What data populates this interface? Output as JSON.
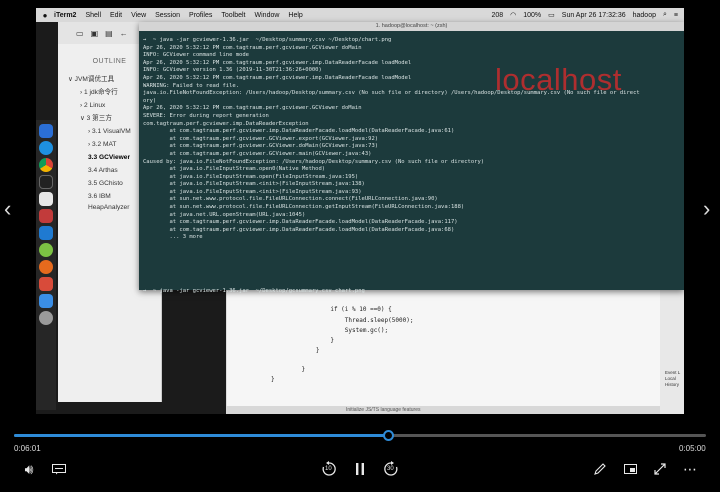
{
  "menubar": {
    "items": [
      "iTerm2",
      "Shell",
      "Edit",
      "View",
      "Session",
      "Profiles",
      "Toolbelt",
      "Window",
      "Help"
    ],
    "battery": "100%",
    "datetime": "Sun Apr 26  17:32:36",
    "user": "hadoop",
    "temp": "208"
  },
  "outline": {
    "title": "OUTLINE",
    "items": [
      {
        "label": "∨ JVM调优工具",
        "level": 0
      },
      {
        "label": "› 1 jdk命令行",
        "level": 1
      },
      {
        "label": "› 2 Linux",
        "level": 1
      },
      {
        "label": "∨ 3 第三方",
        "level": 1
      },
      {
        "label": "› 3.1 VisualVM",
        "level": 2
      },
      {
        "label": "› 3.2 MAT",
        "level": 2
      },
      {
        "label": "3.3 GCViewer",
        "level": 2,
        "active": true
      },
      {
        "label": "3.4 Arthas",
        "level": 2
      },
      {
        "label": "3.5 GChisto",
        "level": 2
      },
      {
        "label": "3.6 IBM",
        "level": 2
      },
      {
        "label": "HeapAnalyzer",
        "level": 2
      }
    ]
  },
  "terminal": {
    "title": "1. hadoop@localhost: ~ (zsh)",
    "lines": [
      "→  ~ java -jar gcviewer-1.36.jar  ~/Desktop/summary.csv ~/Desktop/chart.png",
      "Apr 26, 2020 5:32:12 PM com.tagtraum.perf.gcviewer.GCViewer doMain",
      "INFO: GCViewer command line mode",
      "Apr 26, 2020 5:32:12 PM com.tagtraum.perf.gcviewer.imp.DataReaderFacade loadModel",
      "INFO: GCViewer version 1.36 (2019-11-30T21:36:26+0000)",
      "Apr 26, 2020 5:32:12 PM com.tagtraum.perf.gcviewer.imp.DataReaderFacade loadModel",
      "WARNING: Failed to read file.",
      "java.io.FileNotFoundException: /Users/hadoop/Desktop/summary.csv (No such file or directory) /Users/hadoop/Desktop/summary.csv (No such file or direct",
      "ory)",
      "Apr 26, 2020 5:32:12 PM com.tagtraum.perf.gcviewer.GCViewer doMain",
      "SEVERE: Error during report generation",
      "com.tagtraum.perf.gcviewer.imp.DataReaderException",
      "        at com.tagtraum.perf.gcviewer.imp.DataReaderFacade.loadModel(DataReaderFacade.java:61)",
      "        at com.tagtraum.perf.gcviewer.GCViewer.export(GCViewer.java:92)",
      "        at com.tagtraum.perf.gcviewer.GCViewer.doMain(GCViewer.java:73)",
      "        at com.tagtraum.perf.gcviewer.GCViewer.main(GCViewer.java:43)",
      "Caused by: java.io.FileNotFoundException: /Users/hadoop/Desktop/summary.csv (No such file or directory)",
      "        at java.io.FileInputStream.open0(Native Method)",
      "        at java.io.FileInputStream.open(FileInputStream.java:195)",
      "        at java.io.FileInputStream.<init>(FileInputStream.java:138)",
      "        at java.io.FileInputStream.<init>(FileInputStream.java:93)",
      "        at sun.net.www.protocol.file.FileURLConnection.connect(FileURLConnection.java:90)",
      "        at sun.net.www.protocol.file.FileURLConnection.getInputStream(FileURLConnection.java:188)",
      "        at java.net.URL.openStream(URL.java:1045)",
      "        at com.tagtraum.perf.gcviewer.imp.DataReaderFacade.loadModel(DataReaderFacade.java:117)",
      "        at com.tagtraum.perf.gcviewer.imp.DataReaderFacade.loadModel(DataReaderFacade.java:68)",
      "        ... 3 more"
    ],
    "prompt": "→  ~ java -jar gcviewer-1.36.jar  ~/Desktop/gcsummary.csv chart.png",
    "watermark": "localhost"
  },
  "editor": {
    "lines": [
      "            if (i % 10 ==0) {",
      "                Thread.sleep(5000);",
      "                System.gc();",
      "            }",
      "        }",
      "",
      "    }",
      "}"
    ],
    "status": "Initialize JS/TS language features",
    "side_text": "Event L\nLocal\nHistory"
  },
  "player": {
    "current_time": "0:06:01",
    "total_time": "0:05:00",
    "progress": 0.54,
    "skip_back": "10",
    "skip_forward": "30"
  }
}
